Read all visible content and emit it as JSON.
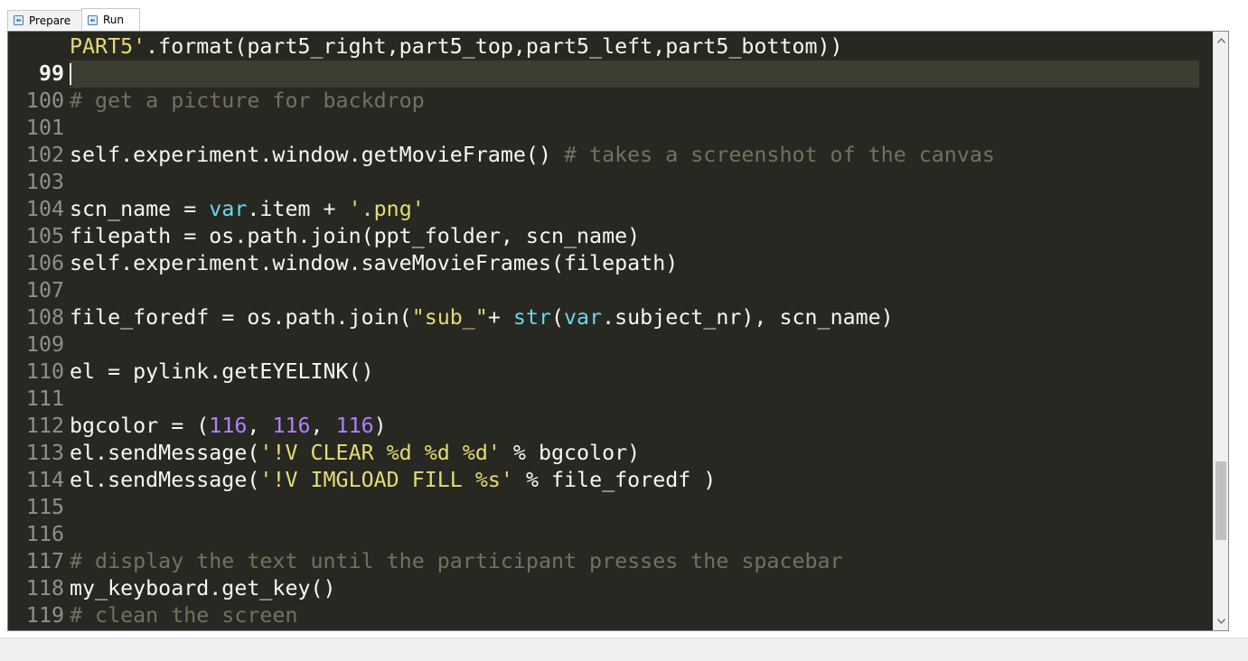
{
  "tabs": [
    {
      "label": "Prepare",
      "icon": "script-icon",
      "active": false
    },
    {
      "label": "Run",
      "icon": "script-icon",
      "active": true
    }
  ],
  "editor": {
    "theme": {
      "background": "#272822",
      "comment": "#75715e",
      "string": "#e6db74",
      "builtin": "#66d9ef",
      "number": "#ae81ff",
      "text": "#f8f8f2"
    },
    "current_line": "99",
    "lines": [
      {
        "n": "",
        "tokens": [
          [
            "s",
            "PART5'"
          ],
          [
            "p",
            ".format(part5_right,part5_top,part5_left,part5_bottom))"
          ]
        ]
      },
      {
        "n": "99",
        "tokens": []
      },
      {
        "n": "100",
        "tokens": [
          [
            "c",
            "# get a picture for backdrop"
          ]
        ]
      },
      {
        "n": "101",
        "tokens": []
      },
      {
        "n": "102",
        "tokens": [
          [
            "p",
            "self.experiment.window.getMovieFrame() "
          ],
          [
            "c",
            "# takes a screenshot of the canvas"
          ]
        ]
      },
      {
        "n": "103",
        "tokens": []
      },
      {
        "n": "104",
        "tokens": [
          [
            "p",
            "scn_name = "
          ],
          [
            "b",
            "var"
          ],
          [
            "p",
            ".item + "
          ],
          [
            "s",
            "'.png'"
          ]
        ]
      },
      {
        "n": "105",
        "tokens": [
          [
            "p",
            "filepath = os.path.join(ppt_folder, scn_name)"
          ]
        ]
      },
      {
        "n": "106",
        "tokens": [
          [
            "p",
            "self.experiment.window.saveMovieFrames(filepath)"
          ]
        ]
      },
      {
        "n": "107",
        "tokens": []
      },
      {
        "n": "108",
        "tokens": [
          [
            "p",
            "file_foredf = os.path.join("
          ],
          [
            "s",
            "\"sub_\""
          ],
          [
            "p",
            "+ "
          ],
          [
            "b",
            "str"
          ],
          [
            "p",
            "("
          ],
          [
            "b",
            "var"
          ],
          [
            "p",
            ".subject_nr), scn_name)"
          ]
        ]
      },
      {
        "n": "109",
        "tokens": []
      },
      {
        "n": "110",
        "tokens": [
          [
            "p",
            "el = pylink.getEYELINK()"
          ]
        ]
      },
      {
        "n": "111",
        "tokens": []
      },
      {
        "n": "112",
        "tokens": [
          [
            "p",
            "bgcolor = ("
          ],
          [
            "n",
            "116"
          ],
          [
            "p",
            ", "
          ],
          [
            "n",
            "116"
          ],
          [
            "p",
            ", "
          ],
          [
            "n",
            "116"
          ],
          [
            "p",
            ")"
          ]
        ]
      },
      {
        "n": "113",
        "tokens": [
          [
            "p",
            "el.sendMessage("
          ],
          [
            "s",
            "'!V CLEAR %d %d %d'"
          ],
          [
            "p",
            " % bgcolor)"
          ]
        ]
      },
      {
        "n": "114",
        "tokens": [
          [
            "p",
            "el.sendMessage("
          ],
          [
            "s",
            "'!V IMGLOAD FILL %s'"
          ],
          [
            "p",
            " % file_foredf )"
          ]
        ]
      },
      {
        "n": "115",
        "tokens": []
      },
      {
        "n": "116",
        "tokens": []
      },
      {
        "n": "117",
        "tokens": [
          [
            "c",
            "# display the text until the participant presses the spacebar"
          ]
        ]
      },
      {
        "n": "118",
        "tokens": [
          [
            "p",
            "my_keyboard.get_key()"
          ]
        ]
      },
      {
        "n": "119",
        "tokens": [
          [
            "c",
            "# clean the screen"
          ]
        ]
      }
    ]
  },
  "scrollbar": {
    "position_fraction": 0.85,
    "visible_fraction": 0.14
  }
}
